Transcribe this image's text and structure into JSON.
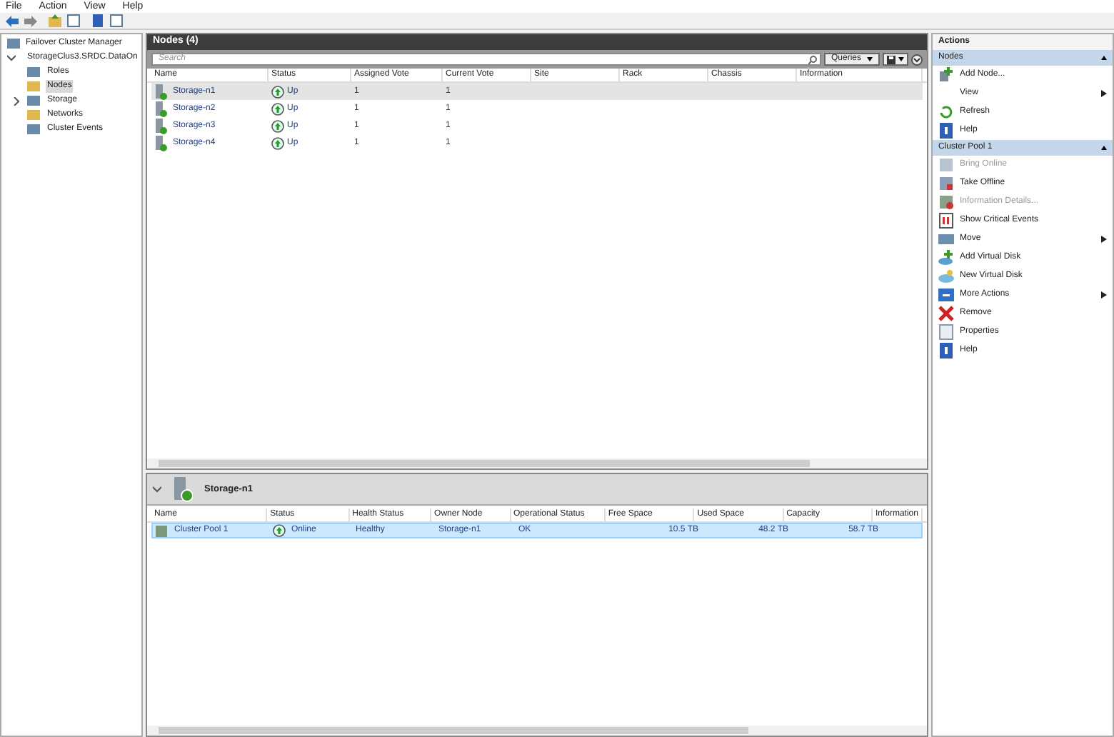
{
  "menu": [
    "File",
    "Action",
    "View",
    "Help"
  ],
  "tree": {
    "label": "Failover Cluster Manager",
    "children": [
      {
        "label": "StorageClus3.SRDC.DataOn",
        "expanded": true,
        "children": [
          {
            "label": "Roles",
            "selected": false,
            "expandable": false
          },
          {
            "label": "Nodes",
            "selected": true,
            "expandable": false
          },
          {
            "label": "Storage",
            "selected": false,
            "expandable": true
          },
          {
            "label": "Networks",
            "selected": false,
            "expandable": false
          },
          {
            "label": "Cluster Events",
            "selected": false,
            "expandable": false
          }
        ]
      }
    ]
  },
  "nodes_panel": {
    "title": "Nodes (4)",
    "search": {
      "placeholder": "Search"
    },
    "queries_button": "Queries",
    "columns": [
      "Name",
      "Status",
      "Assigned Vote",
      "Current Vote",
      "Site",
      "Rack",
      "Chassis",
      "Information"
    ],
    "rows": [
      {
        "name": "Storage-n1",
        "status": "Up",
        "assigned_vote": "1",
        "current_vote": "1",
        "selected": true
      },
      {
        "name": "Storage-n2",
        "status": "Up",
        "assigned_vote": "1",
        "current_vote": "1",
        "selected": false
      },
      {
        "name": "Storage-n3",
        "status": "Up",
        "assigned_vote": "1",
        "current_vote": "1",
        "selected": false
      },
      {
        "name": "Storage-n4",
        "status": "Up",
        "assigned_vote": "1",
        "current_vote": "1",
        "selected": false
      }
    ]
  },
  "detail_panel": {
    "title": "Storage-n1",
    "columns": [
      "Name",
      "Status",
      "Health Status",
      "Owner Node",
      "Operational Status",
      "Free Space",
      "Used Space",
      "Capacity",
      "Information"
    ],
    "rows": [
      {
        "cells": [
          "Cluster Pool 1",
          "Online",
          "Healthy",
          "Storage-n1",
          "OK",
          "10.5 TB",
          "48.2 TB",
          "58.7 TB"
        ],
        "selected": true
      }
    ]
  },
  "actions": {
    "title": "Actions",
    "sections": [
      {
        "title": "Nodes",
        "items": [
          {
            "label": "Add Node...",
            "disabled": false,
            "submenu": false
          },
          {
            "label": "View",
            "disabled": false,
            "submenu": true
          },
          {
            "label": "Refresh",
            "disabled": false,
            "submenu": false
          },
          {
            "label": "Help",
            "disabled": false,
            "submenu": false
          }
        ]
      },
      {
        "title": "Cluster Pool 1",
        "items": [
          {
            "label": "Bring Online",
            "disabled": true,
            "submenu": false
          },
          {
            "label": "Take Offline",
            "disabled": false,
            "submenu": false
          },
          {
            "label": "Information Details...",
            "disabled": true,
            "submenu": false
          },
          {
            "label": "Show Critical Events",
            "disabled": false,
            "submenu": false
          },
          {
            "label": "Move",
            "disabled": false,
            "submenu": true
          },
          {
            "label": "Add Virtual Disk",
            "disabled": false,
            "submenu": false
          },
          {
            "label": "New Virtual Disk",
            "disabled": false,
            "submenu": false
          },
          {
            "label": "More Actions",
            "disabled": false,
            "submenu": true
          },
          {
            "label": "Remove",
            "disabled": false,
            "submenu": false
          },
          {
            "label": "Properties",
            "disabled": false,
            "submenu": false
          },
          {
            "label": "Help",
            "disabled": false,
            "submenu": false
          }
        ]
      }
    ]
  }
}
